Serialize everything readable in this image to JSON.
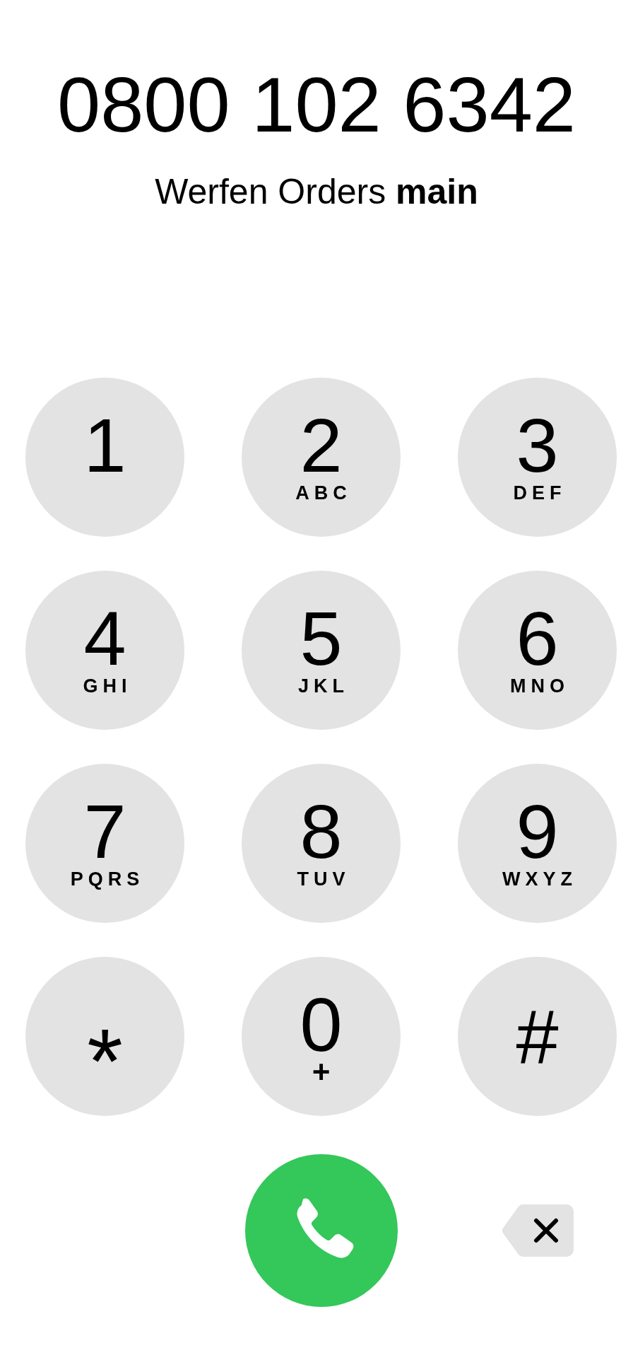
{
  "number": "0800 102 6342",
  "contact": "Werfen Orders **main**",
  "keys": [
    {
      "kind": "digit",
      "digit": "1"
    },
    {
      "kind": "digit",
      "digit": "2",
      "letters": "ABC"
    },
    {
      "kind": "digit",
      "digit": "3",
      "letters": "DEF"
    },
    {
      "kind": "digit",
      "digit": "4",
      "letters": "GHI"
    },
    {
      "kind": "digit",
      "digit": "5",
      "letters": "JKL"
    },
    {
      "kind": "digit",
      "digit": "6",
      "letters": "MNO"
    },
    {
      "kind": "digit",
      "digit": "7",
      "letters": "PQRS"
    },
    {
      "kind": "digit",
      "digit": "8",
      "letters": "TUV"
    },
    {
      "kind": "digit",
      "digit": "9",
      "letters": "WXYZ"
    },
    {
      "kind": "symbol",
      "digit": "*"
    },
    {
      "kind": "digit",
      "digit": "0",
      "letters": "+"
    },
    {
      "kind": "symbol",
      "digit": "#"
    }
  ]
}
